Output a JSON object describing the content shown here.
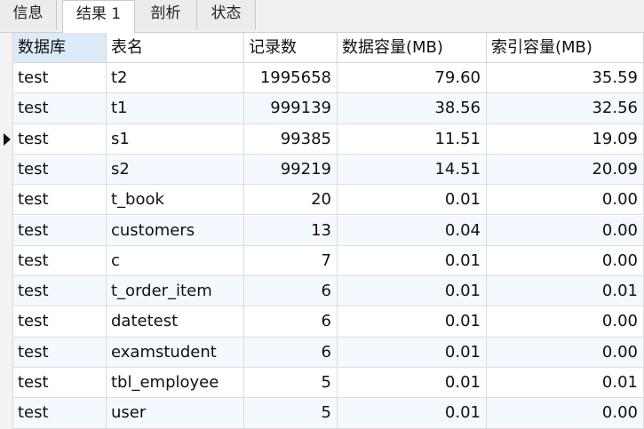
{
  "tabs": [
    {
      "label": "信息",
      "active": false
    },
    {
      "label": "结果 1",
      "active": true
    },
    {
      "label": "剖析",
      "active": false
    },
    {
      "label": "状态",
      "active": false
    }
  ],
  "table": {
    "columns": [
      "数据库",
      "表名",
      "记录数",
      "数据容量(MB)",
      "索引容量(MB)"
    ],
    "current_row": 2,
    "rows": [
      [
        "test",
        "t2",
        "1995658",
        "79.60",
        "35.59"
      ],
      [
        "test",
        "t1",
        "999139",
        "38.56",
        "32.56"
      ],
      [
        "test",
        "s1",
        "99385",
        "11.51",
        "19.09"
      ],
      [
        "test",
        "s2",
        "99219",
        "14.51",
        "20.09"
      ],
      [
        "test",
        "t_book",
        "20",
        "0.01",
        "0.00"
      ],
      [
        "test",
        "customers",
        "13",
        "0.04",
        "0.00"
      ],
      [
        "test",
        "c",
        "7",
        "0.01",
        "0.00"
      ],
      [
        "test",
        "t_order_item",
        "6",
        "0.01",
        "0.01"
      ],
      [
        "test",
        "datetest",
        "6",
        "0.01",
        "0.00"
      ],
      [
        "test",
        "examstudent",
        "6",
        "0.01",
        "0.00"
      ],
      [
        "test",
        "tbl_employee",
        "5",
        "0.01",
        "0.01"
      ],
      [
        "test",
        "user",
        "5",
        "0.01",
        "0.00"
      ]
    ]
  }
}
